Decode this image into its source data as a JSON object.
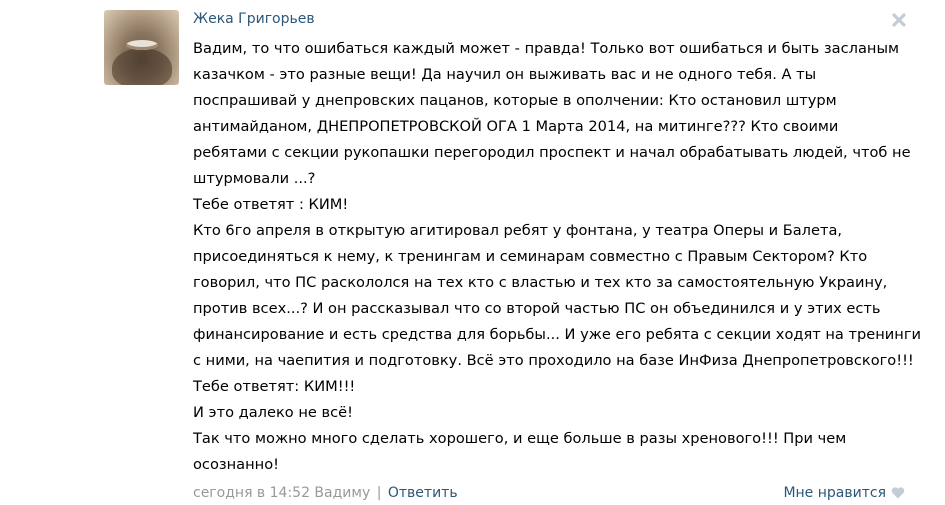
{
  "comment": {
    "author": "Жека Григорьев",
    "lines": [
      "Вадим, то что ошибаться каждый может - правда! Только вот ошибаться и быть засланым",
      "казачком - это разные вещи! Да научил он выживать вас и не одного тебя. А ты",
      "поспрашивай у днепровских пацанов, которые в ополчении: Кто остановил штурм",
      "антимайданом, ДНЕПРОПЕТРОВСКОЙ ОГА 1 Марта 2014, на митинге??? Кто своими",
      "ребятами с секции рукопашки перегородил проспект и начал обрабатывать людей, чтоб не",
      "штурмовали ...?",
      "Тебе ответят : КИМ!",
      "Кто 6го апреля в открытую агитировал ребят у фонтана, у театра Оперы и Балета,",
      "присоединяться к нему, к тренингам и семинарам совместно с Правым Сектором? Кто",
      "говорил, что ПС раскололся на тех кто с властью и тех кто за самостоятельную Украину,",
      "против всех...? И он рассказывал что со второй частью ПС он объединился и у этих есть",
      "финансирование и есть средства для борьбы... И уже его ребята с секции ходят на тренинги",
      "с ними, на чаепития и подготовку. Всё это проходило на базе ИнФиза Днепропетровского!!!",
      "Тебе ответят: КИМ!!!",
      "И это далеко не всё!",
      "Так что можно много сделать хорошего, и еще больше в разы хренового!!! При чем",
      "осознанно!"
    ],
    "timestamp": "сегодня в 14:52 Вадиму",
    "separator": "|",
    "reply_label": "Ответить",
    "like_label": "Мне нравится"
  },
  "icons": {
    "close": "close-icon",
    "like": "heart-icon"
  },
  "colors": {
    "link": "#2b587a",
    "meta": "#999999",
    "close": "#c5ccd4",
    "heart": "#c5ccd4"
  }
}
